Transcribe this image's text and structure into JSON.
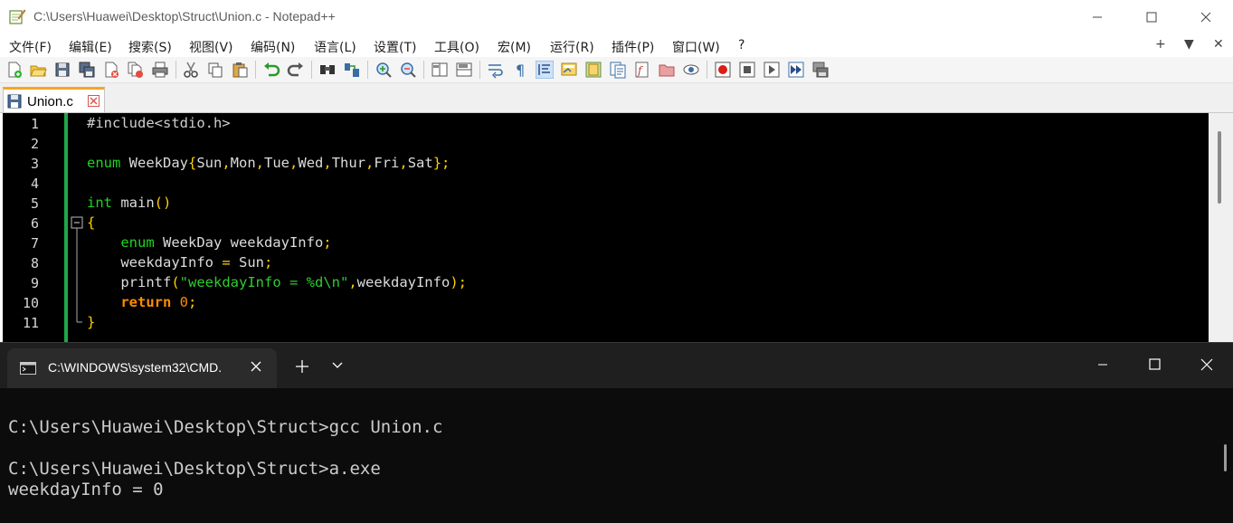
{
  "notepad": {
    "title": "C:\\Users\\Huawei\\Desktop\\Struct\\Union.c - Notepad++",
    "menu": [
      "文件(F)",
      "编辑(E)",
      "搜索(S)",
      "视图(V)",
      "编码(N)",
      "语言(L)",
      "设置(T)",
      "工具(O)",
      "宏(M)",
      "运行(R)",
      "插件(P)",
      "窗口(W)",
      "?"
    ],
    "menu_right": [
      "+",
      "▼",
      "✕"
    ],
    "toolbar_icons": [
      "new-file-icon",
      "open-file-icon",
      "save-icon",
      "save-all-icon",
      "close-icon",
      "close-all-icon",
      "print-icon",
      "cut-icon",
      "copy-icon",
      "paste-icon",
      "undo-icon",
      "redo-icon",
      "find-icon",
      "replace-icon",
      "zoom-in-icon",
      "zoom-out-icon",
      "sync-vertical-icon",
      "sync-horizontal-icon",
      "word-wrap-icon",
      "show-all-chars-icon",
      "indent-guide-icon",
      "udl-icon",
      "doc-map-icon",
      "doc-list-icon",
      "function-list-icon",
      "folder-workspace-icon",
      "monitoring-icon",
      "record-macro-icon",
      "stop-record-icon",
      "play-macro-icon",
      "run-macro-multiple-icon",
      "save-macro-icon"
    ],
    "tab": {
      "label": "Union.c"
    },
    "code": {
      "line_numbers": [
        "1",
        "2",
        "3",
        "4",
        "5",
        "6",
        "7",
        "8",
        "9",
        "10",
        "11"
      ],
      "l1": "#include<stdio.h>",
      "l3_kw": "enum",
      "l3_rest": " WeekDay",
      "l3_values": [
        "Sun",
        "Mon",
        "Tue",
        "Wed",
        "Thur",
        "Fri",
        "Sat"
      ],
      "l5_kw": "int",
      "l5_rest": " main",
      "l7_kw": "enum",
      "l7_rest": " WeekDay weekdayInfo",
      "l8_lhs": "weekdayInfo",
      "l8_rhs": "Sun",
      "l9_fn": "printf",
      "l9_str": "\"weekdayInfo = %d\\n\"",
      "l9_arg": "weekdayInfo",
      "l10_kw": "return",
      "l10_num": "0"
    }
  },
  "terminal": {
    "tab_label": "C:\\WINDOWS\\system32\\CMD.",
    "lines": [
      "C:\\Users\\Huawei\\Desktop\\Struct>gcc Union.c",
      "",
      "C:\\Users\\Huawei\\Desktop\\Struct>a.exe",
      "weekdayInfo = 0"
    ]
  },
  "colors": {
    "editor_bg": "#000000",
    "keyword": "#1fd41f",
    "operator": "#ffd000",
    "string": "#2ecc2e",
    "return_keyword": "#ff8c00",
    "terminal_bg": "#0c0c0c",
    "tab_accent": "#f5a623"
  }
}
